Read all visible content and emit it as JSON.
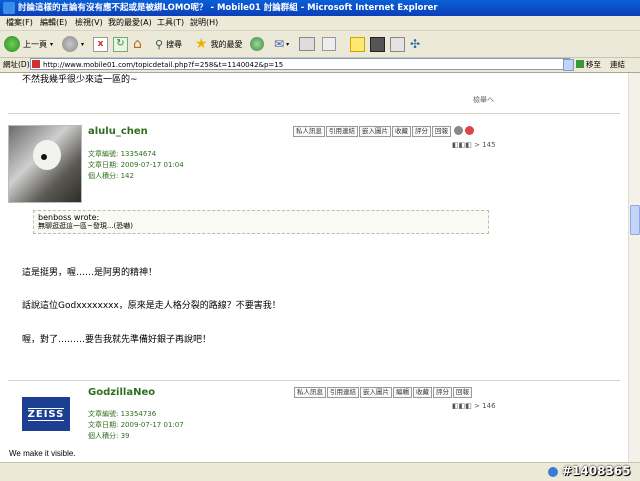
{
  "window": {
    "title": "討論這樣的言論有沒有應不起或是被綁LOMO呢？ - Mobile01 討論群組 - Microsoft Internet Explorer"
  },
  "menu": [
    "檔案(F)",
    "編輯(E)",
    "檢視(V)",
    "我的最愛(A)",
    "工具(T)",
    "說明(H)"
  ],
  "toolbar": {
    "back": "上一頁",
    "search": "搜尋",
    "favorites": "我的最愛"
  },
  "address": {
    "label": "網址(D)",
    "url": "http://www.mobile01.com/topicdetail.php?f=258&t=1140042&p=15",
    "go": "移至",
    "links": "連結"
  },
  "page": {
    "top_text": "不然我幾乎很少來這一區的~",
    "report_link": "檢舉ヘ",
    "posts": [
      {
        "username": "alulu_chen",
        "buttons": [
          "私人訊息",
          "引用連結",
          "嵌入圖片",
          "收藏",
          "評分",
          "回報"
        ],
        "nav": "◧◧◧ > 145",
        "article_count": "文章編號: 13354674",
        "date": "文章日期: 2009-07-17 01:04",
        "points": "個人積分: 142",
        "quote_author": "benboss wrote:",
        "quote_text": "無聊逛逛這一區~發現...(恐嚇)",
        "lines": [
          "這是挺男，喔……是阿男的精神！",
          "話說這位Godxxxxxxxx，原來是走人格分裂的路線？不要害我！",
          "喔，對了………要告我就先準備好銀子再說吧！"
        ]
      },
      {
        "username": "GodzillaNeo",
        "buttons": [
          "私人訊息",
          "引用連結",
          "嵌入圖片",
          "編輯",
          "收藏",
          "評分",
          "回報"
        ],
        "nav": "◧◧◧ > 146",
        "article_count": "文章編號: 13354736",
        "date": "文章日期: 2009-07-17 01:07",
        "points": "個人積分: 39",
        "logo_text": "ZEISS",
        "slogan": "We make it visible."
      }
    ]
  },
  "watermark": "#1408365",
  "colors": {
    "accent_green": "#2e6f1f",
    "titlebar_blue": "#0b4fce",
    "zeiss_blue": "#1c3f94"
  }
}
